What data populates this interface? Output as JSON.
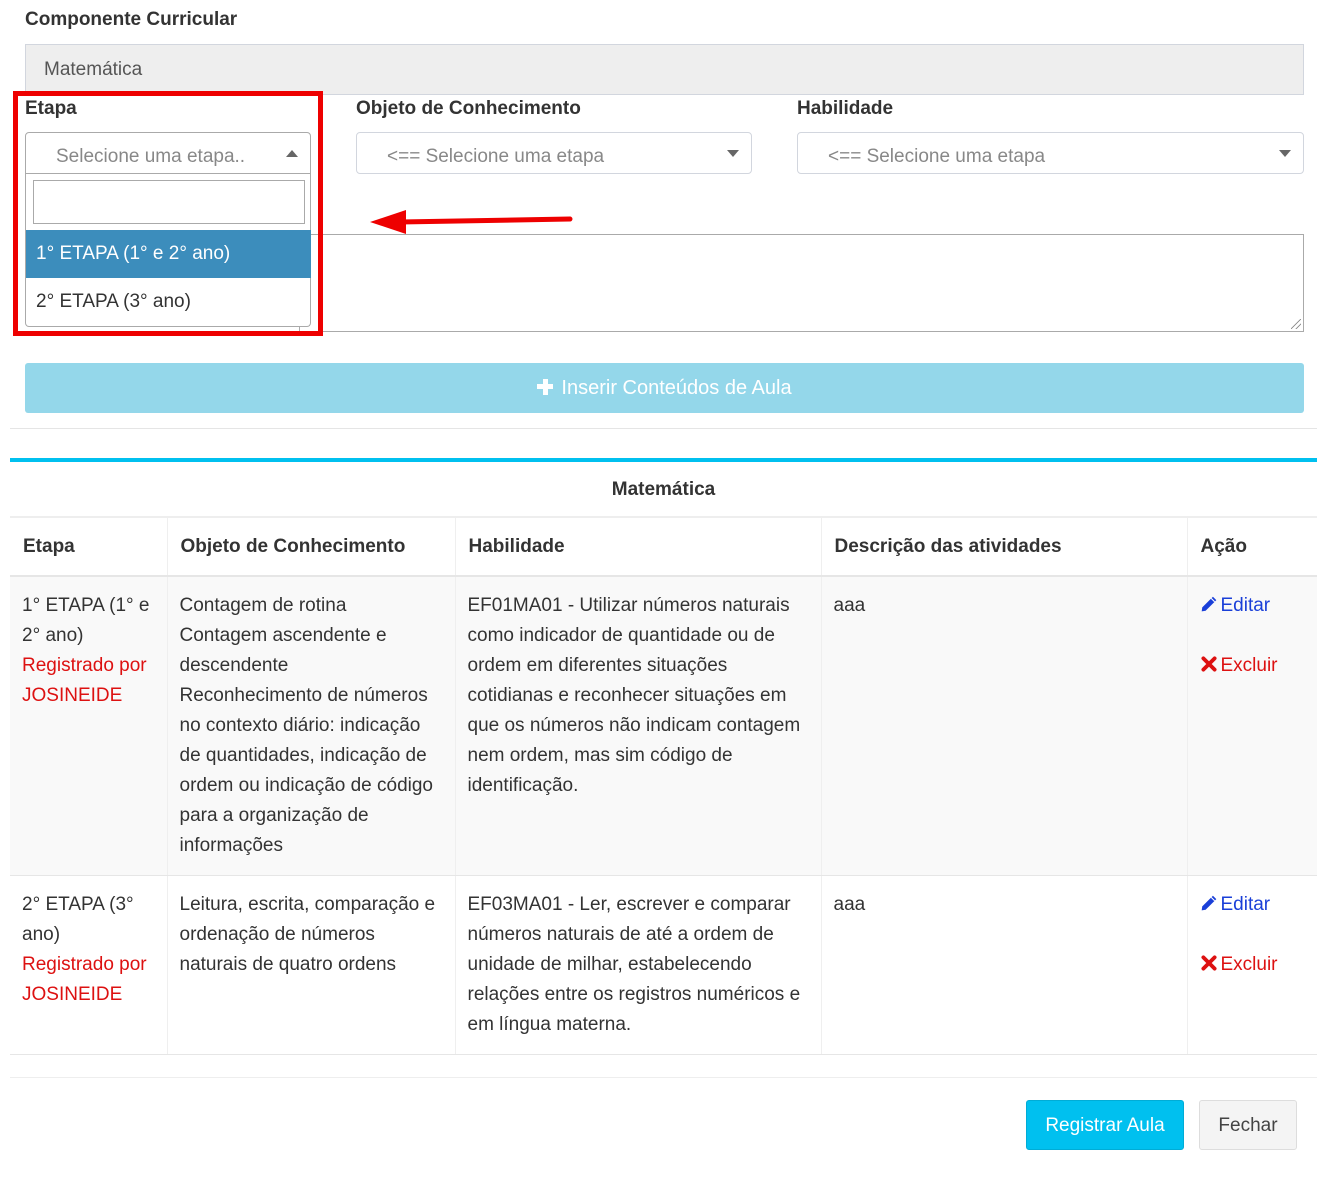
{
  "form": {
    "componente_label": "Componente Curricular",
    "componente_value": "Matemática",
    "etapa_label": "Etapa",
    "etapa_placeholder": "Selecione uma etapa..",
    "objeto_label": "Objeto de Conhecimento",
    "objeto_placeholder": "<== Selecione uma etapa",
    "habilidade_label": "Habilidade",
    "habilidade_placeholder": "<== Selecione uma etapa",
    "etapa_options": [
      "1° ETAPA (1° e 2° ano)",
      "2° ETAPA (3° ano)"
    ],
    "insert_button": "Inserir Conteúdos de Aula"
  },
  "annotation": {
    "highlight_color": "#ee0000",
    "arrow_color": "#ee0000"
  },
  "table": {
    "title": "Matemática",
    "headers": [
      "Etapa",
      "Objeto de Conhecimento",
      "Habilidade",
      "Descrição das atividades",
      "Ação"
    ],
    "rows": [
      {
        "etapa": "1° ETAPA (1° e 2° ano)",
        "registrado": "Registrado por JOSINEIDE",
        "objeto": [
          "Contagem de rotina",
          "Contagem ascendente e descendente",
          "Reconhecimento de números no contexto diário: indicação de quantidades, indicação de ordem ou indicação de código para a organização de informações"
        ],
        "habilidade": "EF01MA01 - Utilizar números naturais como indicador de quantidade ou de ordem em diferentes situações cotidianas e reconhecer situações em que os números não indicam contagem nem ordem, mas sim código de identificação.",
        "descricao": "aaa",
        "edit": "Editar",
        "delete": "Excluir"
      },
      {
        "etapa": "2° ETAPA (3° ano)",
        "registrado": "Registrado por JOSINEIDE",
        "objeto": [
          "Leitura, escrita, comparação e ordenação de números naturais de quatro ordens"
        ],
        "habilidade": "EF03MA01 - Ler, escrever e comparar números naturais de até a ordem de unidade de milhar, estabelecendo relações entre os registros numéricos e em língua materna.",
        "descricao": "aaa",
        "edit": "Editar",
        "delete": "Excluir"
      }
    ]
  },
  "footer": {
    "register_button": "Registrar Aula",
    "close_button": "Fechar"
  },
  "colors": {
    "primary": "#00c0ef",
    "selected_option": "#3c8dbc",
    "danger": "#dd1111",
    "link": "#1a3fd8"
  }
}
